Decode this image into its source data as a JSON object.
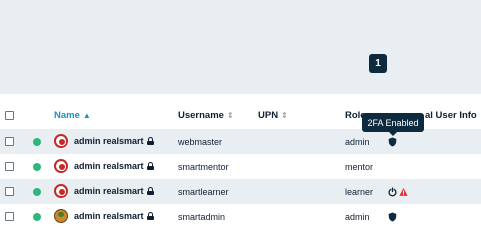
{
  "pagination": {
    "current_page": "1"
  },
  "table": {
    "columns": {
      "name": "Name",
      "username": "Username",
      "upn": "UPN",
      "role": "Role",
      "user_info": "al User Info"
    },
    "rows": [
      {
        "display_name": "admin realsmart",
        "username": "webmaster",
        "role": "admin",
        "status_icons": [
          "shield-icon"
        ],
        "avatar": "target-avatar"
      },
      {
        "display_name": "admin realsmart",
        "username": "smartmentor",
        "role": "mentor",
        "status_icons": [],
        "avatar": "target-avatar"
      },
      {
        "display_name": "admin realsmart",
        "username": "smartlearner",
        "role": "learner",
        "status_icons": [
          "power-icon",
          "warning-icon"
        ],
        "avatar": "target-avatar"
      },
      {
        "display_name": "admin realsmart",
        "username": "smartadmin",
        "role": "admin",
        "status_icons": [
          "shield-icon"
        ],
        "avatar": "photo-avatar"
      }
    ]
  },
  "tooltip": {
    "text": "2FA Enabled"
  },
  "colors": {
    "status_active": "#2eb67d",
    "accent": "#1f8ec4",
    "dark": "#0d2a3f",
    "warning": "#e03131"
  }
}
